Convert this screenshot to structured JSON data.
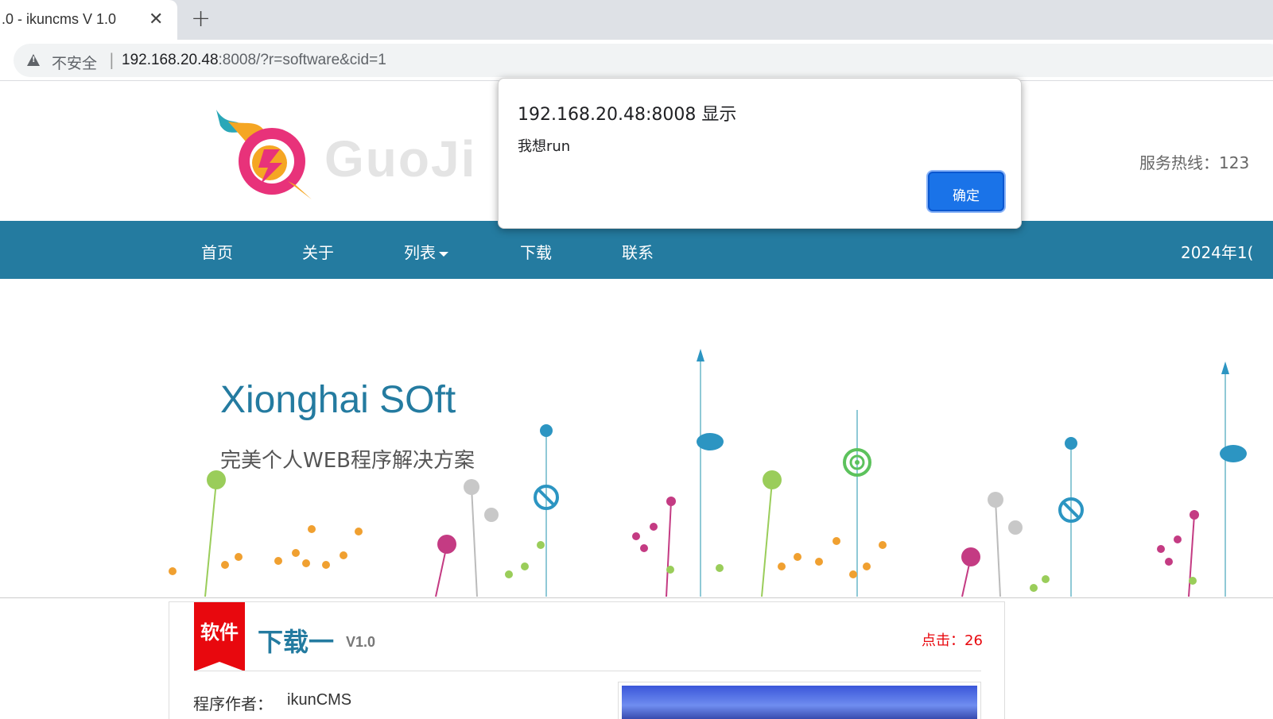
{
  "browser": {
    "tab_title": ".0 - ikuncms V 1.0",
    "tab_close": "✕",
    "new_tab": "+",
    "insecure_label": "不安全",
    "separator": "|",
    "url_host": "192.168.20.48",
    "url_rest": ":8008/?r=software&cid=1"
  },
  "header": {
    "logo_text": "GuoJi",
    "hotline": "服务热线：123"
  },
  "nav": {
    "items": [
      "首页",
      "关于",
      "列表",
      "下载",
      "联系"
    ],
    "date": "2024年1("
  },
  "banner": {
    "title": "Xionghai SOft",
    "subtitle": "完美个人WEB程序解决方案"
  },
  "card": {
    "ribbon": "软件",
    "title": "下载一",
    "version": "V1.0",
    "clicks": "点击：26",
    "author_label": "程序作者：",
    "author_value": "ikunCMS"
  },
  "dialog": {
    "title": "192.168.20.48:8008 显示",
    "message": "我想run",
    "ok_label": "确定"
  },
  "colors": {
    "nav_bg": "#247ba0",
    "ribbon": "#e8080e",
    "button": "#1a73e8"
  },
  "icons": [
    "warning-icon",
    "close-icon",
    "plus-icon",
    "logo-icon",
    "caret-down-icon"
  ]
}
